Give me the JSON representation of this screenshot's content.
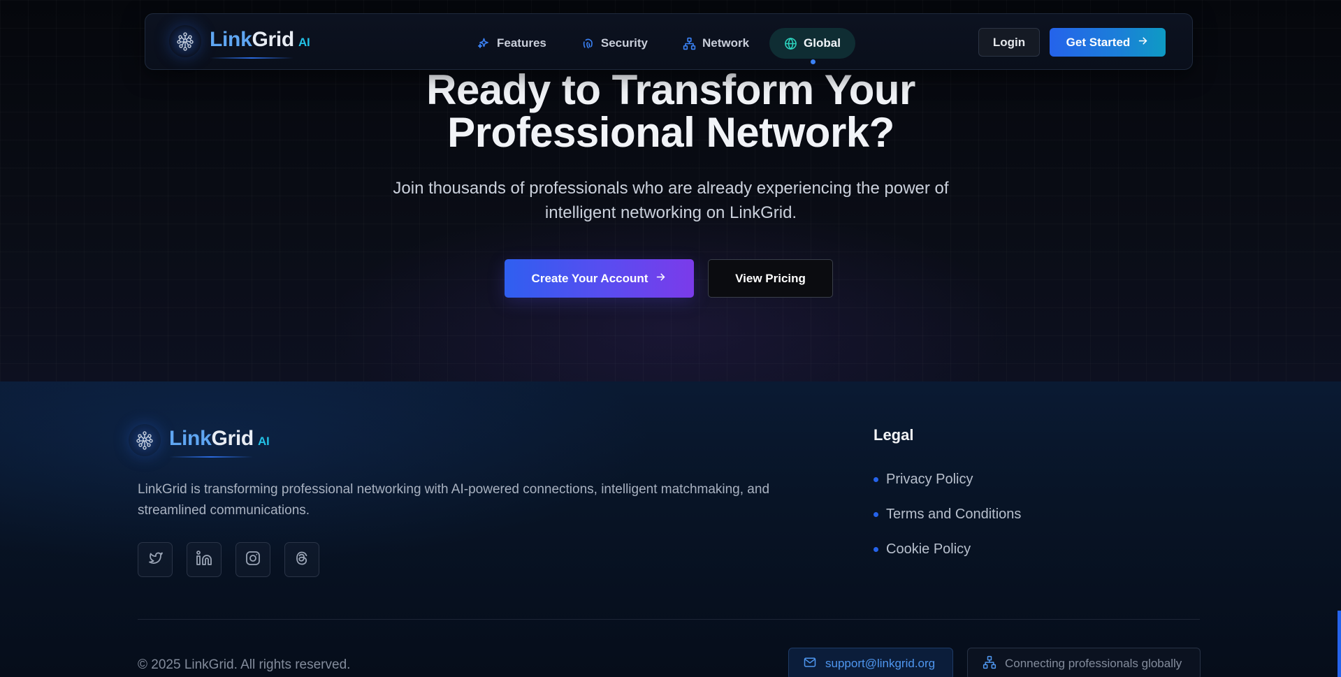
{
  "colors": {
    "accent": "#2563eb",
    "brand_link": "#5fa6f2",
    "brand_ai": "#22c1e6",
    "background": "#05070c",
    "footer_bg": "#0a1a33"
  },
  "nav": {
    "brand": {
      "link": "Link",
      "grid": "Grid",
      "ai": "AI",
      "icon": "network-brain-icon"
    },
    "links": [
      {
        "label": "Features",
        "icon": "sparkles-icon",
        "active": false
      },
      {
        "label": "Security",
        "icon": "fingerprint-icon",
        "active": false
      },
      {
        "label": "Network",
        "icon": "network-icon",
        "active": false
      },
      {
        "label": "Global",
        "icon": "globe-icon",
        "active": true
      }
    ],
    "login_label": "Login",
    "get_started_label": "Get Started"
  },
  "hero": {
    "title_line1": "Ready to Transform Your",
    "title_line2": "Professional Network?",
    "subtitle": "Join thousands of professionals who are already experiencing the power of intelligent networking on LinkGrid.",
    "create_account_label": "Create Your Account",
    "view_pricing_label": "View Pricing"
  },
  "footer": {
    "brand": {
      "link": "Link",
      "grid": "Grid",
      "ai": "AI"
    },
    "description": "LinkGrid is transforming professional networking with AI-powered connections, intelligent matchmaking, and streamlined communications.",
    "socials": [
      "twitter-icon",
      "linkedin-icon",
      "instagram-icon",
      "threads-icon"
    ],
    "legal_title": "Legal",
    "legal_links": [
      "Privacy Policy",
      "Terms and Conditions",
      "Cookie Policy"
    ],
    "copyright": "© 2025 LinkGrid. All rights reserved.",
    "email": "support@linkgrid.org",
    "tagline": "Connecting professionals globally"
  }
}
